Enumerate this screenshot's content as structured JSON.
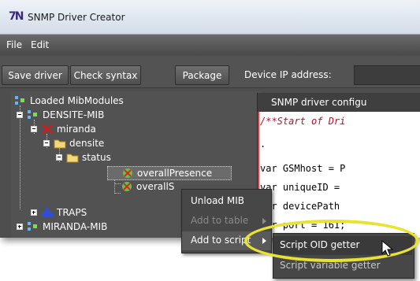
{
  "window": {
    "title": "SNMP Driver Creator",
    "icon_text": "7N"
  },
  "menu": [
    {
      "label": "File"
    },
    {
      "label": "Edit"
    }
  ],
  "toolbar": {
    "save_label": "Save driver",
    "check_label": "Check syntax",
    "package_label": "Package",
    "ip_label": "Device IP address:",
    "ip_value": ""
  },
  "tree": {
    "root_label": "Loaded MibModules",
    "densite_mib": "DENSITE-MIB",
    "miranda": "miranda",
    "densite": "densite",
    "status": "status",
    "overall_presence": "overallPresence",
    "overall_s": "overallS",
    "traps": "TRAPS",
    "miranda_mib": "MIRANDA-MIB"
  },
  "editor": {
    "tab_title": "SNMP driver configu",
    "lines": [
      {
        "text": "/**Start of Dri",
        "kind": "comment"
      },
      {
        "text": ".",
        "kind": "code"
      },
      {
        "text": "var GSMhost = P",
        "kind": "code"
      },
      {
        "text": "var uniqueID =",
        "kind": "code"
      },
      {
        "text": "var devicePath",
        "kind": "code"
      },
      {
        "text": "var port = 161;",
        "kind": "code"
      }
    ]
  },
  "context_menu": {
    "unload": "Unload MIB",
    "add_table": "Add to table",
    "add_script": "Add to script"
  },
  "submenu": {
    "script_oid_getter": "Script OID getter",
    "script_variable_getter": "Script variable getter"
  },
  "colors": {
    "highlight": "#e8e233",
    "comment": "#b0122a",
    "dark_bg": "#4e4e4e"
  },
  "icons": {
    "folder": "folder-icon",
    "mib": "mib-module-icon",
    "node": "oid-node-icon",
    "cursor": "mouse-pointer-icon"
  }
}
